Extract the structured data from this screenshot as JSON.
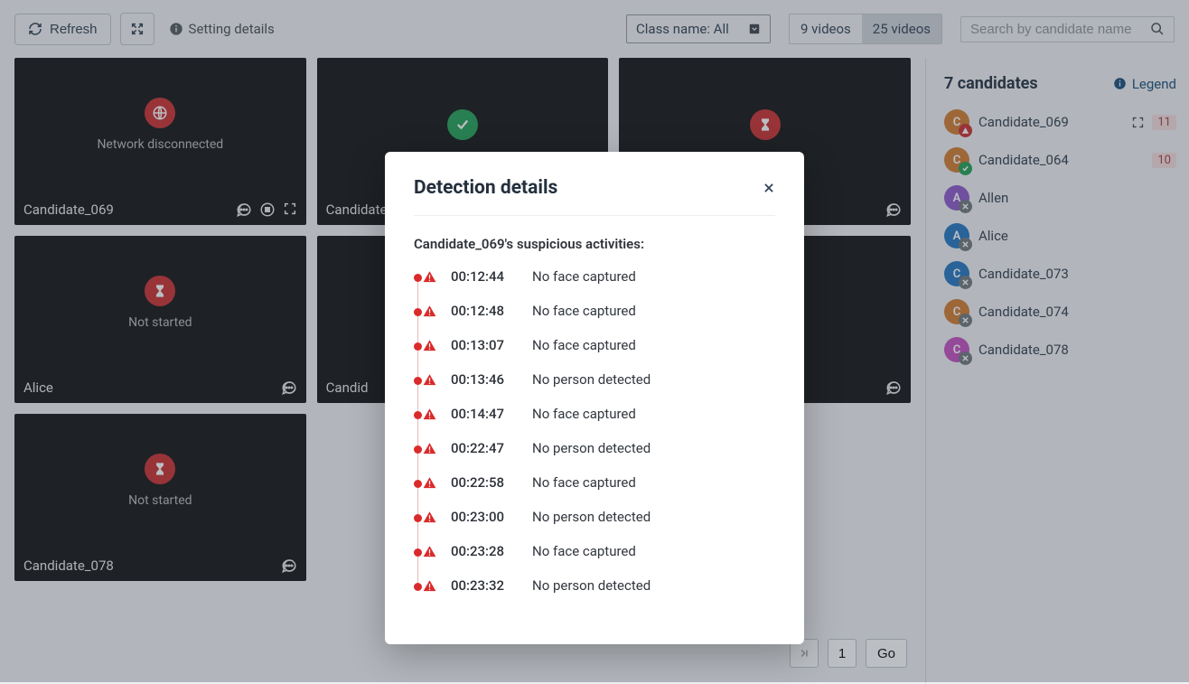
{
  "toolbar": {
    "refresh_label": "Refresh",
    "settings_label": "Setting details",
    "class_filter": {
      "label": "Class name: All"
    },
    "view_toggle": {
      "opt1": "9 videos",
      "opt2": "25 videos"
    },
    "search_placeholder": "Search by candidate name"
  },
  "tiles": [
    {
      "name": "Candidate_069",
      "status": "Network disconnected",
      "icon": "globe",
      "icon_color": "red",
      "footer_icons": [
        "chat",
        "record",
        "expand"
      ]
    },
    {
      "name": "Candidate_",
      "status": "",
      "icon": "check",
      "icon_color": "green",
      "footer_icons": []
    },
    {
      "name": "",
      "status": "",
      "icon": "hourglass",
      "icon_color": "red",
      "footer_icons": [
        "chat"
      ]
    },
    {
      "name": "Alice",
      "status": "Not started",
      "icon": "hourglass",
      "icon_color": "red",
      "footer_icons": [
        "chat"
      ]
    },
    {
      "name": "Candid",
      "status": "",
      "icon": "",
      "icon_color": "",
      "footer_icons": []
    },
    {
      "name": "",
      "status": "",
      "icon": "",
      "icon_color": "",
      "footer_icons": [
        "chat"
      ]
    },
    {
      "name": "Candidate_078",
      "status": "Not started",
      "icon": "hourglass",
      "icon_color": "red",
      "footer_icons": [
        "chat"
      ]
    }
  ],
  "pager": {
    "current": "1",
    "go_label": "Go"
  },
  "sidebar": {
    "title": "7 candidates",
    "legend_label": "Legend",
    "items": [
      {
        "initial": "C",
        "color": "#d17a2b",
        "badge": "warn",
        "name": "Candidate_069",
        "count": "11",
        "expandable": true
      },
      {
        "initial": "C",
        "color": "#d17a2b",
        "badge": "ok",
        "name": "Candidate_064",
        "count": "10",
        "expandable": false
      },
      {
        "initial": "A",
        "color": "#8a55c9",
        "badge": "off",
        "name": "Allen",
        "count": "",
        "expandable": false
      },
      {
        "initial": "A",
        "color": "#1f74c0",
        "badge": "off",
        "name": "Alice",
        "count": "",
        "expandable": false
      },
      {
        "initial": "C",
        "color": "#1f74c0",
        "badge": "off",
        "name": "Candidate_073",
        "count": "",
        "expandable": false
      },
      {
        "initial": "C",
        "color": "#d17a2b",
        "badge": "off",
        "name": "Candidate_074",
        "count": "",
        "expandable": false
      },
      {
        "initial": "C",
        "color": "#c44cc0",
        "badge": "off",
        "name": "Candidate_078",
        "count": "",
        "expandable": false
      }
    ]
  },
  "modal": {
    "title": "Detection details",
    "subtitle": "Candidate_069's suspicious activities:",
    "events": [
      {
        "time": "00:12:44",
        "desc": "No face captured"
      },
      {
        "time": "00:12:48",
        "desc": "No face captured"
      },
      {
        "time": "00:13:07",
        "desc": "No face captured"
      },
      {
        "time": "00:13:46",
        "desc": "No person detected"
      },
      {
        "time": "00:14:47",
        "desc": "No face captured"
      },
      {
        "time": "00:22:47",
        "desc": "No person detected"
      },
      {
        "time": "00:22:58",
        "desc": "No face captured"
      },
      {
        "time": "00:23:00",
        "desc": "No person detected"
      },
      {
        "time": "00:23:28",
        "desc": "No face captured"
      },
      {
        "time": "00:23:32",
        "desc": "No person detected"
      }
    ]
  }
}
